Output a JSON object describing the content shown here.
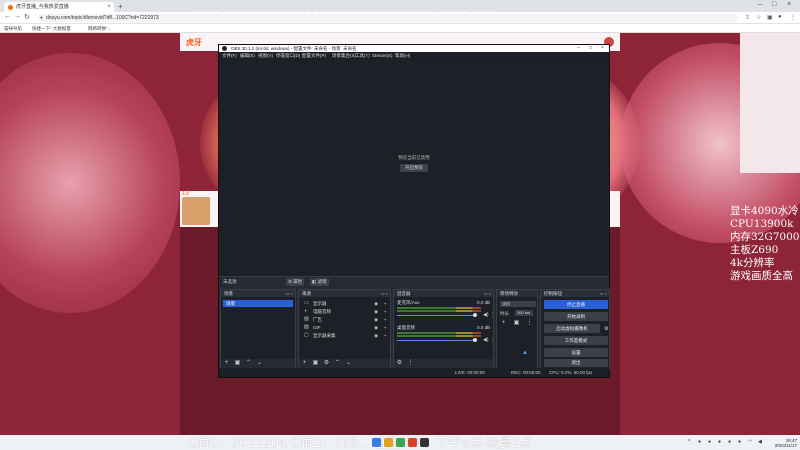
{
  "browser": {
    "tab_title": "虎牙直播_与我热爱直播",
    "url": "douyu.com/topic/dlemovid?dfl...100C?rid=7222973",
    "bookmarks": [
      "猫咪导航",
      "快捷一下\" 大数据量",
      "网络转换\"..."
    ]
  },
  "obs": {
    "title": "OBS 30.1.2 (64-bit, windows) - 配置文件: 未命名 - 场景: 未命名",
    "menu": [
      "文件(F)",
      "编辑(E)",
      "视图(V)",
      "停靠窗口(D)",
      "配置文件(P)",
      "场景集合(S)",
      "工具(T)",
      "Stream(S)",
      "帮助(H)"
    ],
    "preview_message": "预览当前已禁用",
    "preview_button": "开启预览",
    "scenebar_label": "未选源",
    "scenebar_props": "属性",
    "scenebar_filters": "滤镜",
    "docks": {
      "scenes": "场景",
      "sources": "来源",
      "mixer": "混音器",
      "transitions": "转场特效",
      "controls": "控制按钮"
    },
    "scenes": [
      "场景"
    ],
    "sources": [
      {
        "icon": "display-icon",
        "name": "显示器"
      },
      {
        "icon": "audio-icon",
        "name": "电脑音频"
      },
      {
        "icon": "image-icon",
        "name": "广告"
      },
      {
        "icon": "image-icon",
        "name": "GIF"
      },
      {
        "icon": "window-icon",
        "name": "显示器采集"
      }
    ],
    "mixer": [
      {
        "name": "麦克风/Aux",
        "db": "0.0 dB"
      },
      {
        "name": "桌面音频",
        "db": "0.0 dB"
      }
    ],
    "transition": {
      "type_label": "淡出",
      "duration_label": "时长",
      "duration_value": "300 ms"
    },
    "controls": [
      "停止直播",
      "开始录制",
      "启动虚拟摄像机",
      "工作室模式",
      "设置",
      "退出"
    ],
    "status": {
      "live": "LIVE: 00:00:00",
      "rec": "REC: 00:00:00",
      "cpu": "CPU: 0.2%, 60.00 fps"
    }
  },
  "overlay_specs": [
    "显卡4090水冷",
    "CPU13900k",
    "内存32G7000",
    "主板Z690",
    "4k分辨率",
    "游戏画质全高"
  ],
  "ticker": "Q群1：3622204      Q群2：105...      直播时间：下午4点-凌晨2点",
  "room_count": "13",
  "clock": {
    "time": "16:47",
    "date": "2023/11/17"
  }
}
